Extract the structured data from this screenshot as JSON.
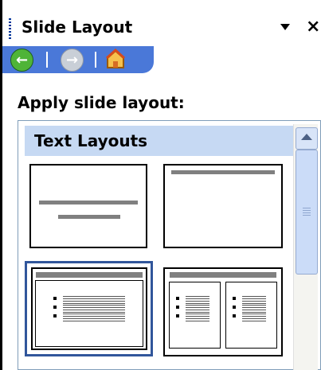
{
  "header": {
    "title": "Slide Layout",
    "close": "×"
  },
  "nav": {
    "back_icon": "back-arrow-icon",
    "forward_icon": "forward-arrow-icon",
    "home_icon": "home-icon"
  },
  "apply_label": "Apply slide layout:",
  "section_title": "Text Layouts",
  "colors": {
    "nav_bg": "#4a78d8",
    "section_bg": "#c6d9f3",
    "selected_border": "#31569b"
  },
  "layouts": [
    {
      "name": "Title Slide",
      "selected": false
    },
    {
      "name": "Title Only",
      "selected": false
    },
    {
      "name": "Title and Text",
      "selected": true
    },
    {
      "name": "Title and 2-Column Text",
      "selected": false
    }
  ]
}
